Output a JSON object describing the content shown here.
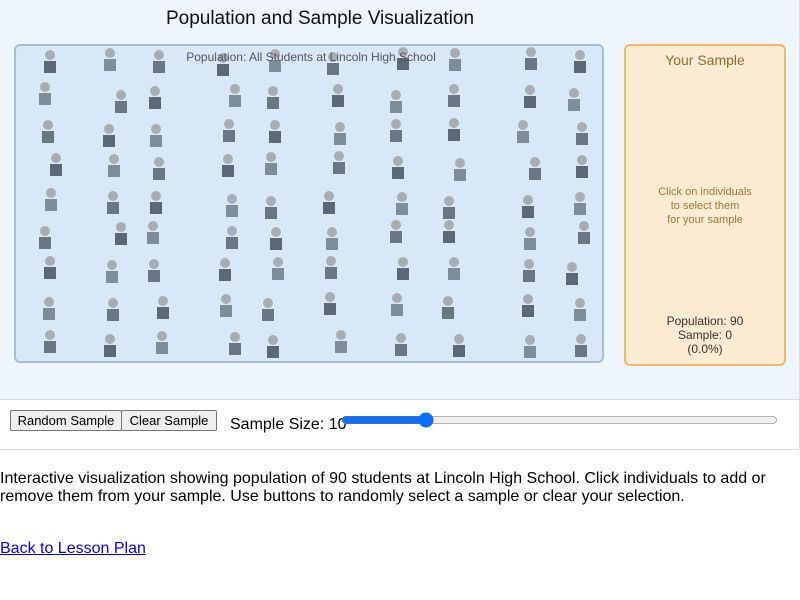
{
  "viz": {
    "title": "Population and Sample Visualization",
    "population_label": "Population: All Students at Lincoln High School",
    "people_count": 90
  },
  "sample": {
    "title": "Your Sample",
    "hint_line1": "Click on individuals",
    "hint_line2": "to select them",
    "hint_line3": "for your sample",
    "population_stat": "Population: 90",
    "sample_stat": "Sample: 0",
    "percent_stat": "(0.0%)"
  },
  "controls": {
    "random_label": "Random Sample",
    "clear_label": "Clear Sample",
    "size_label": "Sample Size: 10",
    "slider_min": "1",
    "slider_max": "50",
    "slider_value": "10"
  },
  "description": "Interactive visualization showing population of 90 students at Lincoln High School. Click individuals to add or remove them from your sample. Use buttons to randomly select a sample or clear your selection.",
  "back_link": "Back to Lesson Plan",
  "colors": {
    "population_bg": "#d8e8f9",
    "sample_bg": "#fdebd3",
    "sample_border": "#f4b769",
    "link": "#0000ee"
  }
}
